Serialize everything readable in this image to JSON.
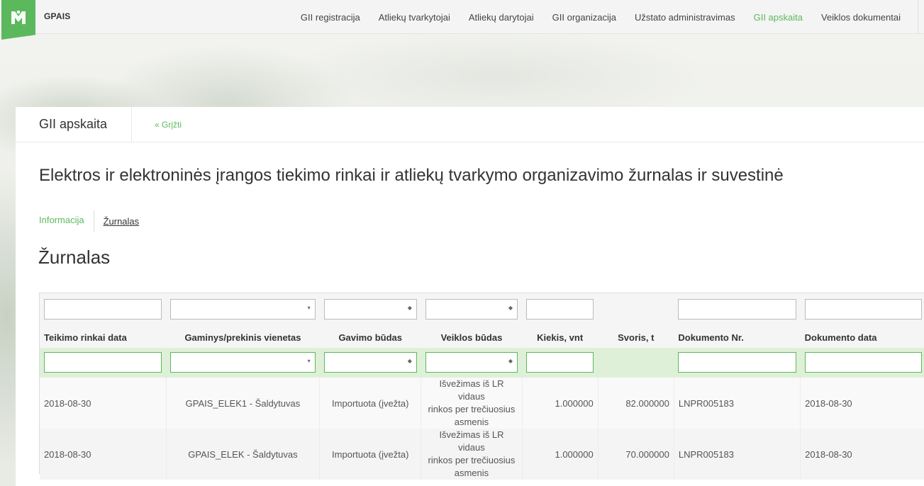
{
  "brand": "GPAIS",
  "nav": [
    {
      "label": "GII registracija",
      "active": false
    },
    {
      "label": "Atliekų tvarkytojai",
      "active": false
    },
    {
      "label": "Atliekų darytojai",
      "active": false
    },
    {
      "label": "GII organizacija",
      "active": false
    },
    {
      "label": "Užstato administravimas",
      "active": false
    },
    {
      "label": "GII apskaita",
      "active": true
    },
    {
      "label": "Veiklos dokumentai",
      "active": false
    }
  ],
  "panel": {
    "title": "GII apskaita",
    "back_link": "« Grįžti"
  },
  "page_heading": "Elektros ir elektroninės įrangos tiekimo rinkai ir atliekų tvarkymo organizavimo žurnalas ir suvestinė",
  "subtabs": {
    "info": "Informacija",
    "journal": "Žurnalas"
  },
  "section_title": "Žurnalas",
  "table": {
    "columns": [
      "Teikimo rinkai data",
      "Gaminys/prekinis vienetas",
      "Gavimo būdas",
      "Veiklos būdas",
      "Kiekis, vnt",
      "Svoris, t",
      "Dokumento Nr.",
      "Dokumento data"
    ],
    "rows": [
      {
        "date": "2018-08-30",
        "product": "GPAIS_ELEK1 - Šaldytuvas",
        "receipt": "Importuota (įvežta)",
        "activity_lines": [
          "Išvežimas iš LR vidaus",
          "rinkos per trečiuosius",
          "asmenis"
        ],
        "qty": "1.000000",
        "weight": "82.000000",
        "doc_no": "LNPR005183",
        "doc_date": "2018-08-30"
      },
      {
        "date": "2018-08-30",
        "product": "GPAIS_ELEK - Šaldytuvas",
        "receipt": "Importuota (įvežta)",
        "activity_lines": [
          "Išvežimas iš LR vidaus",
          "rinkos per trečiuosius",
          "asmenis"
        ],
        "qty": "1.000000",
        "weight": "70.000000",
        "doc_no": "LNPR005183",
        "doc_date": "2018-08-30"
      }
    ]
  },
  "colors": {
    "accent": "#5cb85c",
    "filter_row_bg": "#dff0d8"
  }
}
